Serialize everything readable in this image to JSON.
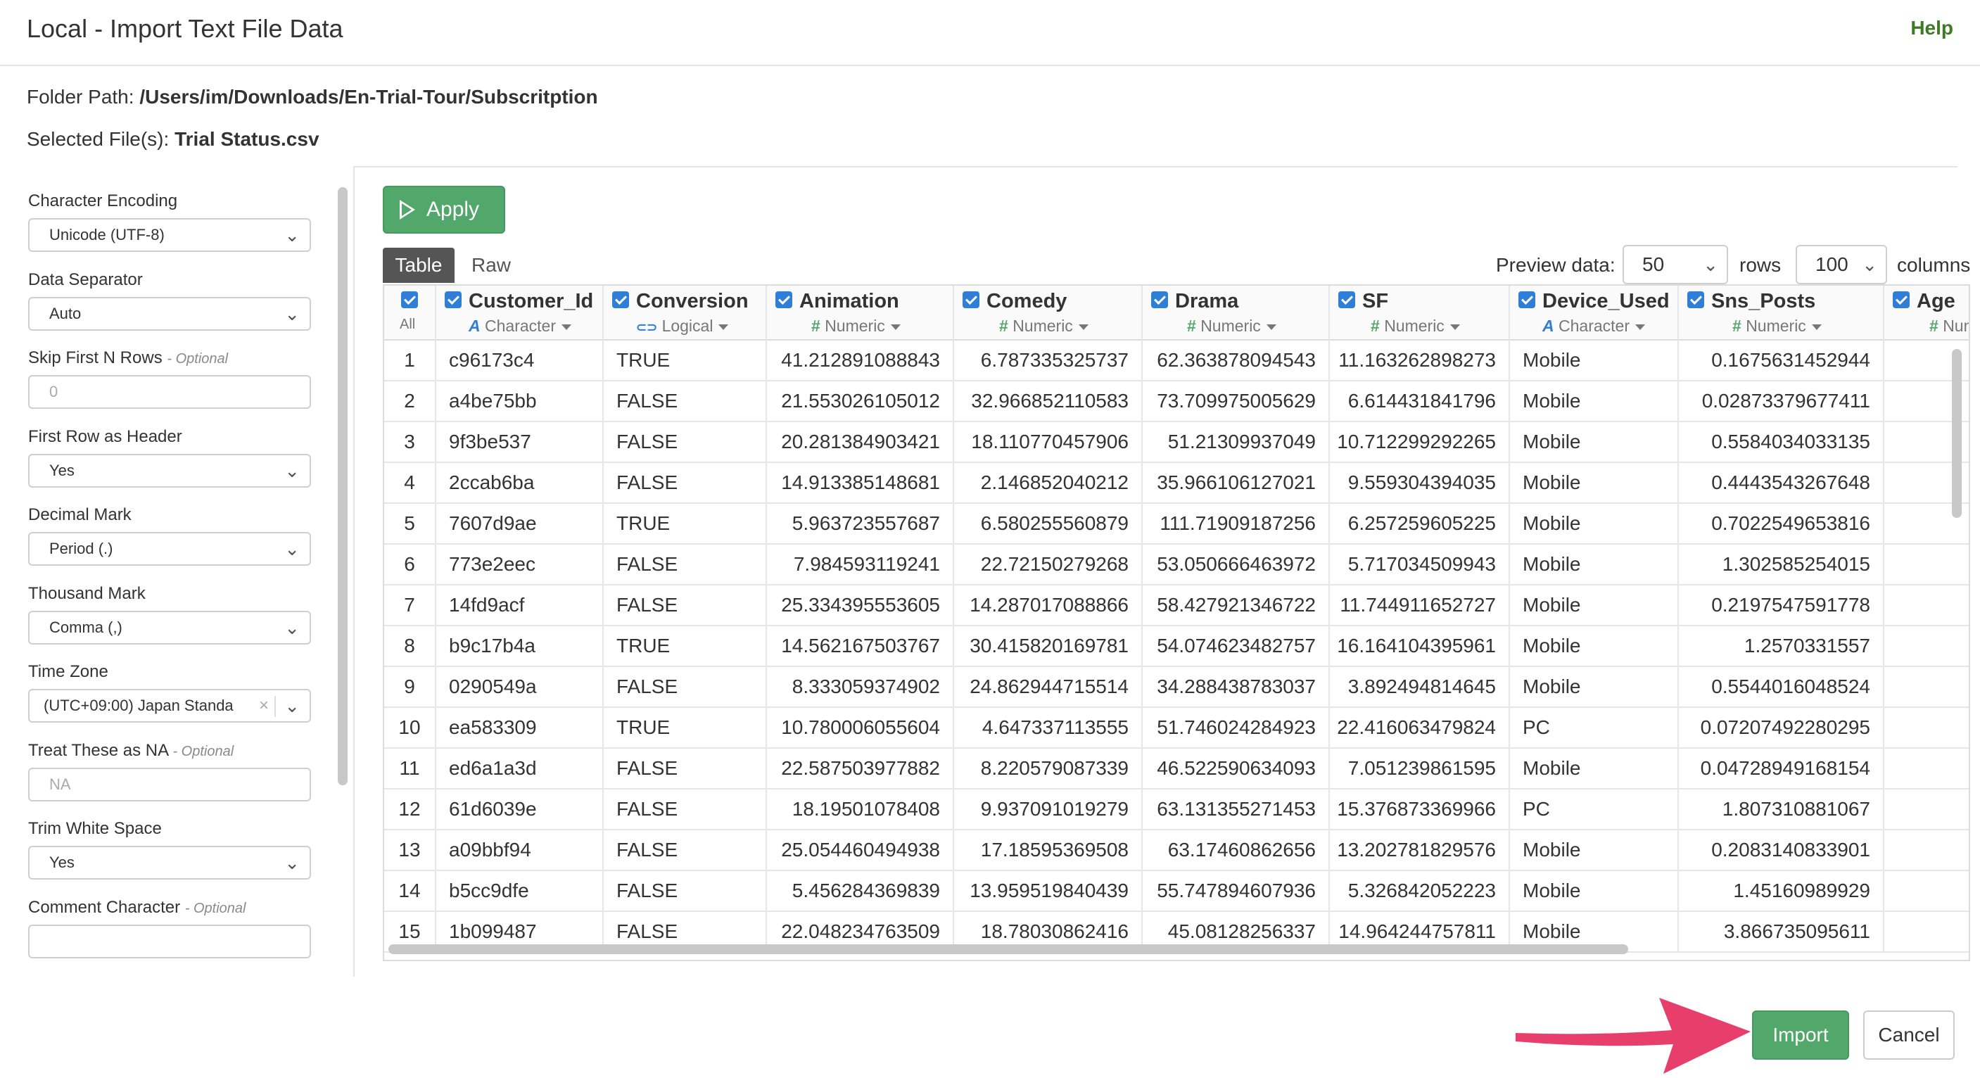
{
  "dialog": {
    "title": "Local - Import Text File Data",
    "help_label": "Help"
  },
  "folder": {
    "label": "Folder Path:",
    "value": "/Users/im/Downloads/En-Trial-Tour/Subscritption"
  },
  "selected": {
    "label": "Selected File(s):",
    "value": "Trial Status.csv"
  },
  "settings": [
    {
      "label": "Character Encoding",
      "optional": "",
      "kind": "select",
      "value": "Unicode (UTF-8)"
    },
    {
      "label": "Data Separator",
      "optional": "",
      "kind": "select",
      "value": "Auto"
    },
    {
      "label": "Skip First N Rows",
      "optional": "- Optional",
      "kind": "input",
      "value": "0"
    },
    {
      "label": "First Row as Header",
      "optional": "",
      "kind": "select",
      "value": "Yes"
    },
    {
      "label": "Decimal Mark",
      "optional": "",
      "kind": "select",
      "value": "Period (.)"
    },
    {
      "label": "Thousand Mark",
      "optional": "",
      "kind": "select",
      "value": "Comma (,)"
    },
    {
      "label": "Time Zone",
      "optional": "",
      "kind": "select-clear",
      "value": "(UTC+09:00) Japan Standa"
    },
    {
      "label": "Treat These as NA",
      "optional": "- Optional",
      "kind": "input",
      "value": "NA"
    },
    {
      "label": "Trim White Space",
      "optional": "",
      "kind": "select",
      "value": "Yes"
    },
    {
      "label": "Comment Character",
      "optional": "- Optional",
      "kind": "input",
      "value": ""
    }
  ],
  "apply_label": "Apply",
  "tabs": {
    "table": "Table",
    "raw": "Raw"
  },
  "preview": {
    "label": "Preview data:",
    "rows_value": "50",
    "rows_label": "rows",
    "cols_value": "100",
    "cols_label": "columns"
  },
  "all_label": "All",
  "columns": [
    {
      "name": "Customer_Id",
      "type": "Character",
      "icon": "A"
    },
    {
      "name": "Conversion",
      "type": "Logical",
      "icon": "toggle"
    },
    {
      "name": "Animation",
      "type": "Numeric",
      "icon": "#"
    },
    {
      "name": "Comedy",
      "type": "Numeric",
      "icon": "#"
    },
    {
      "name": "Drama",
      "type": "Numeric",
      "icon": "#"
    },
    {
      "name": "SF",
      "type": "Numeric",
      "icon": "#"
    },
    {
      "name": "Device_Used",
      "type": "Character",
      "icon": "A"
    },
    {
      "name": "Sns_Posts",
      "type": "Numeric",
      "icon": "#"
    },
    {
      "name": "Age",
      "type": "Nume",
      "icon": "#"
    }
  ],
  "rows": [
    [
      "1",
      "c96173c4",
      "TRUE",
      "41.212891088843",
      "6.787335325737",
      "62.363878094543",
      "11.163262898273",
      "Mobile",
      "0.1675631452944"
    ],
    [
      "2",
      "a4be75bb",
      "FALSE",
      "21.553026105012",
      "32.966852110583",
      "73.709975005629",
      "6.614431841796",
      "Mobile",
      "0.02873379677411"
    ],
    [
      "3",
      "9f3be537",
      "FALSE",
      "20.281384903421",
      "18.110770457906",
      "51.21309937049",
      "10.712299292265",
      "Mobile",
      "0.5584034033135"
    ],
    [
      "4",
      "2ccab6ba",
      "FALSE",
      "14.913385148681",
      "2.146852040212",
      "35.966106127021",
      "9.559304394035",
      "Mobile",
      "0.4443543267648"
    ],
    [
      "5",
      "7607d9ae",
      "TRUE",
      "5.963723557687",
      "6.580255560879",
      "111.71909187256",
      "6.257259605225",
      "Mobile",
      "0.7022549653816"
    ],
    [
      "6",
      "773e2eec",
      "FALSE",
      "7.984593119241",
      "22.72150279268",
      "53.050666463972",
      "5.717034509943",
      "Mobile",
      "1.302585254015"
    ],
    [
      "7",
      "14fd9acf",
      "FALSE",
      "25.334395553605",
      "14.287017088866",
      "58.427921346722",
      "11.744911652727",
      "Mobile",
      "0.2197547591778"
    ],
    [
      "8",
      "b9c17b4a",
      "TRUE",
      "14.562167503767",
      "30.415820169781",
      "54.074623482757",
      "16.164104395961",
      "Mobile",
      "1.2570331557"
    ],
    [
      "9",
      "0290549a",
      "FALSE",
      "8.333059374902",
      "24.862944715514",
      "34.288438783037",
      "3.892494814645",
      "Mobile",
      "0.5544016048524"
    ],
    [
      "10",
      "ea583309",
      "TRUE",
      "10.780006055604",
      "4.647337113555",
      "51.746024284923",
      "22.416063479824",
      "PC",
      "0.07207492280295"
    ],
    [
      "11",
      "ed6a1a3d",
      "FALSE",
      "22.587503977882",
      "8.220579087339",
      "46.522590634093",
      "7.051239861595",
      "Mobile",
      "0.04728949168154"
    ],
    [
      "12",
      "61d6039e",
      "FALSE",
      "18.19501078408",
      "9.937091019279",
      "63.131355271453",
      "15.376873369966",
      "PC",
      "1.807310881067"
    ],
    [
      "13",
      "a09bbf94",
      "FALSE",
      "25.054460494938",
      "17.18595369508",
      "63.17460862656",
      "13.202781829576",
      "Mobile",
      "0.2083140833901"
    ],
    [
      "14",
      "b5cc9dfe",
      "FALSE",
      "5.456284369839",
      "13.959519840439",
      "55.747894607936",
      "5.326842052223",
      "Mobile",
      "1.45160989929"
    ],
    [
      "15",
      "1b099487",
      "FALSE",
      "22.048234763509",
      "18.78030862416",
      "45.08128256337",
      "14.964244757811",
      "Mobile",
      "3.866735095611"
    ]
  ],
  "footer": {
    "import_label": "Import",
    "cancel_label": "Cancel"
  },
  "colors": {
    "accent_green": "#52a86a",
    "help_green": "#3d7a26",
    "checkbox_blue": "#2f7ed8",
    "arrow_pink": "#e83e6c"
  }
}
